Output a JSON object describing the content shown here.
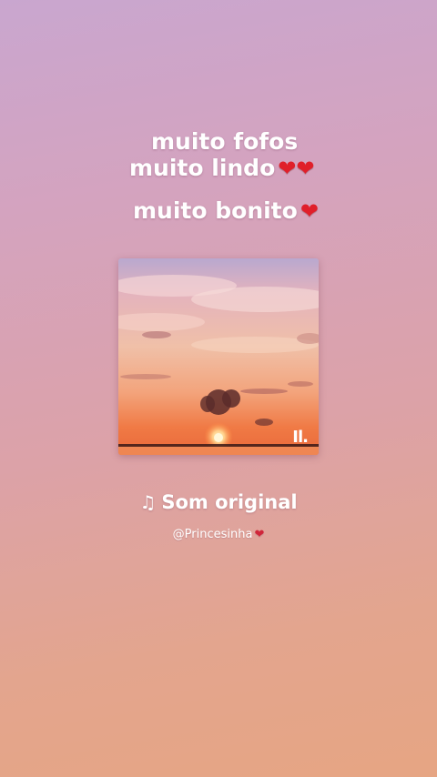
{
  "captions": {
    "line1": "muito fofos",
    "line2": "muito lindo",
    "line2_emoji": "❤❤",
    "line3": "muito bonito",
    "line3_emoji": "❤"
  },
  "sound": {
    "title": "Som original",
    "icon": "music-note-icon",
    "author": "@Princesinha",
    "author_emoji": "❤",
    "bars_icon": "sound-bars-icon"
  },
  "colors": {
    "background_top": "#c9a6cf",
    "background_bottom": "#e6a583",
    "heart": "#e01f2a",
    "text": "#ffffff"
  }
}
